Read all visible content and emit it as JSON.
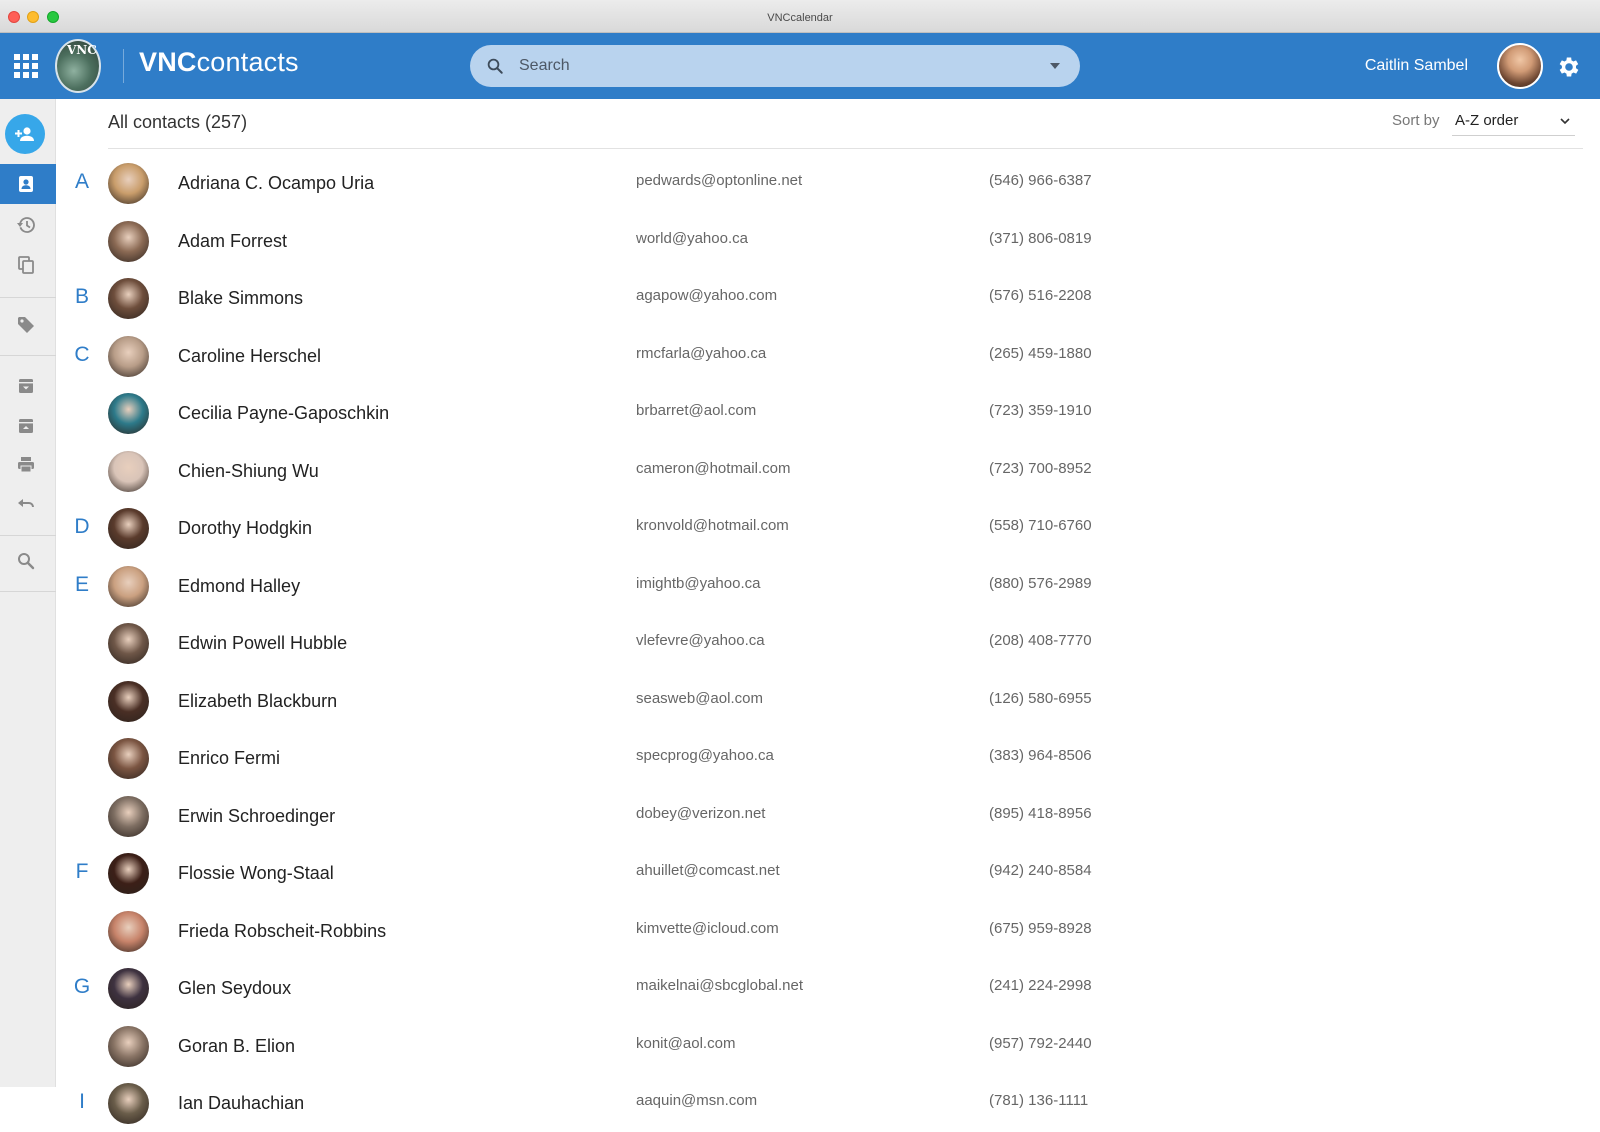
{
  "window": {
    "title": "VNCcalendar"
  },
  "header": {
    "app_name_bold": "VNC",
    "app_name_rest": "contacts",
    "search_placeholder": "Search",
    "user_name": "Caitlin Sambel"
  },
  "content": {
    "title": "All contacts (257)",
    "sort_label": "Sort by",
    "sort_value": "A-Z order"
  },
  "colors": {
    "primary": "#2f7dc8",
    "accent": "#37a7e9",
    "sidebar_bg": "#eeeeee"
  },
  "sidebar_icons": [
    "add-contact-icon",
    "contacts-icon",
    "history-icon",
    "copy-icon",
    "tag-icon",
    "archive-icon",
    "unarchive-icon",
    "print-icon",
    "undo-icon",
    "search-icon"
  ],
  "contacts": [
    {
      "letter": "A",
      "name": "Adriana C. Ocampo Uria",
      "email": "pedwards@optonline.net",
      "phone": "(546) 966-6387",
      "avatar_color": "#c99d6b"
    },
    {
      "letter": "",
      "name": "Adam Forrest",
      "email": "world@yahoo.ca",
      "phone": "(371) 806-0819",
      "avatar_color": "#8b6a54"
    },
    {
      "letter": "B",
      "name": "Blake Simmons",
      "email": "agapow@yahoo.com",
      "phone": "(576) 516-2208",
      "avatar_color": "#6e4e3c"
    },
    {
      "letter": "C",
      "name": "Caroline Herschel",
      "email": "rmcfarla@yahoo.ca",
      "phone": "(265) 459-1880",
      "avatar_color": "#b89d88"
    },
    {
      "letter": "",
      "name": "Cecilia Payne-Gaposchkin",
      "email": "brbarret@aol.com",
      "phone": "(723) 359-1910",
      "avatar_color": "#2d7a8a"
    },
    {
      "letter": "",
      "name": "Chien-Shiung Wu",
      "email": "cameron@hotmail.com",
      "phone": "(723) 700-8952",
      "avatar_color": "#d9c4b8"
    },
    {
      "letter": "D",
      "name": "Dorothy Hodgkin",
      "email": "kronvold@hotmail.com",
      "phone": "(558) 710-6760",
      "avatar_color": "#5a3b2c"
    },
    {
      "letter": "E",
      "name": "Edmond Halley",
      "email": "imightb@yahoo.ca",
      "phone": "(880) 576-2989",
      "avatar_color": "#caa080"
    },
    {
      "letter": "",
      "name": "Edwin Powell Hubble",
      "email": "vlefevre@yahoo.ca",
      "phone": "(208) 408-7770",
      "avatar_color": "#6f5748"
    },
    {
      "letter": "",
      "name": "Elizabeth Blackburn",
      "email": "seasweb@aol.com",
      "phone": "(126) 580-6955",
      "avatar_color": "#4a2f25"
    },
    {
      "letter": "",
      "name": "Enrico Fermi",
      "email": "specprog@yahoo.ca",
      "phone": "(383) 964-8506",
      "avatar_color": "#7b5542"
    },
    {
      "letter": "",
      "name": "Erwin Schroedinger",
      "email": "dobey@verizon.net",
      "phone": "(895) 418-8956",
      "avatar_color": "#7e6e62"
    },
    {
      "letter": "F",
      "name": "Flossie Wong-Staal",
      "email": "ahuillet@comcast.net",
      "phone": "(942) 240-8584",
      "avatar_color": "#3c1f17"
    },
    {
      "letter": "",
      "name": "Frieda Robscheit-Robbins",
      "email": "kimvette@icloud.com",
      "phone": "(675) 959-8928",
      "avatar_color": "#c7836a"
    },
    {
      "letter": "G",
      "name": "Glen Seydoux",
      "email": "maikelnai@sbcglobal.net",
      "phone": "(241) 224-2998",
      "avatar_color": "#3e3240"
    },
    {
      "letter": "",
      "name": "Goran B. Elion",
      "email": "konit@aol.com",
      "phone": "(957) 792-2440",
      "avatar_color": "#8a7566"
    },
    {
      "letter": "I",
      "name": "Ian Dauhachian",
      "email": "aaquin@msn.com",
      "phone": "(781) 136-1111",
      "avatar_color": "#6a5d4a"
    }
  ]
}
